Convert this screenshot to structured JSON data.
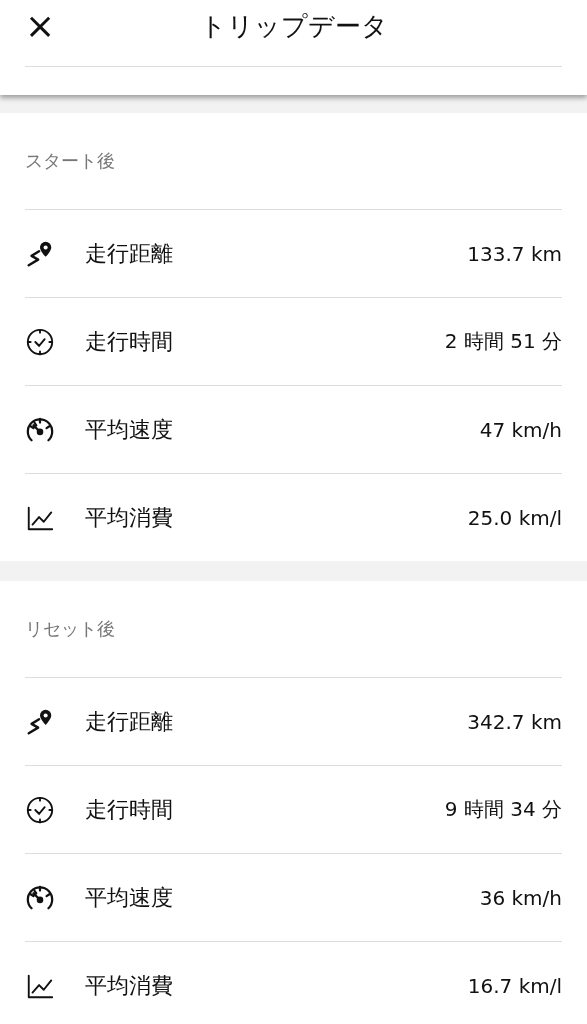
{
  "header": {
    "close": "×",
    "title": "トリップデータ"
  },
  "sections": [
    {
      "label": "スタート後",
      "rows": [
        {
          "kind": "distance",
          "label": "走行距離",
          "value": "133.7 km"
        },
        {
          "kind": "time",
          "label": "走行時間",
          "value": "2 時間 51 分"
        },
        {
          "kind": "speed",
          "label": "平均速度",
          "value": "47 km/h"
        },
        {
          "kind": "consumption",
          "label": "平均消費",
          "value": "25.0 km/l"
        }
      ]
    },
    {
      "label": "リセット後",
      "rows": [
        {
          "kind": "distance",
          "label": "走行距離",
          "value": "342.7 km"
        },
        {
          "kind": "time",
          "label": "走行時間",
          "value": "9 時間 34 分"
        },
        {
          "kind": "speed",
          "label": "平均速度",
          "value": "36 km/h"
        },
        {
          "kind": "consumption",
          "label": "平均消費",
          "value": "16.7 km/l"
        }
      ]
    }
  ]
}
